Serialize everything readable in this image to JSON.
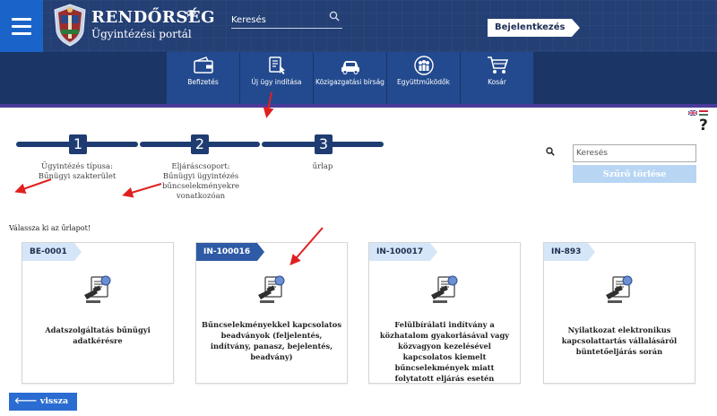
{
  "header": {
    "brand_title": "RENDŐRSÉG",
    "brand_subtitle": "Ügyintézési portál",
    "search_placeholder": "Keresés",
    "login_label": "Bejelentkezés"
  },
  "nav": [
    {
      "label": "Befizetés",
      "icon": "wallet-icon"
    },
    {
      "label": "Új ügy indítása",
      "icon": "form-pointer-icon"
    },
    {
      "label": "Közigazgatási bírság",
      "icon": "car-icon"
    },
    {
      "label": "Együttműködők",
      "icon": "people-icon"
    },
    {
      "label": "Kosár",
      "icon": "cart-icon"
    }
  ],
  "stepper": [
    {
      "number": "1",
      "caption": "Ügyintézés típusa:",
      "value": "Bűnügyi szakterület"
    },
    {
      "number": "2",
      "caption": "Eljáráscsoport:",
      "value": "Bűnügyi ügyintézés bűncselekményekre vonatkozóan"
    },
    {
      "number": "3",
      "caption": "űrlap",
      "value": ""
    }
  ],
  "filter": {
    "placeholder": "Keresés",
    "clear_label": "Szűrő törlése"
  },
  "choose_label": "Válassza ki az űrlapot!",
  "cards": [
    {
      "code": "BE-0001",
      "title": "Adatszolgáltatás bűnügyi adatkérésre"
    },
    {
      "code": "IN-100016",
      "title": "Bűncselekményekkel kapcsolatos beadványok (feljelentés, indítvány, panasz, bejelentés, beadvány)"
    },
    {
      "code": "IN-100017",
      "title": "Felülbírálati indítvány a közhatalom gyakorlásával vagy közvagyon kezelésével kapcsolatos kiemelt bűncselekmények miatt folytatott eljárás esetén"
    },
    {
      "code": "IN-893",
      "title": "Nyilatkozat elektronikus kapcsolattartás vállalásáról büntetőeljárás során"
    }
  ],
  "back_label": "vissza",
  "colors": {
    "header_bg": "#1d3a6e",
    "nav_item_bg": "#234a8f",
    "accent_blue": "#2a6cd1",
    "annotation_red": "#e02020"
  }
}
